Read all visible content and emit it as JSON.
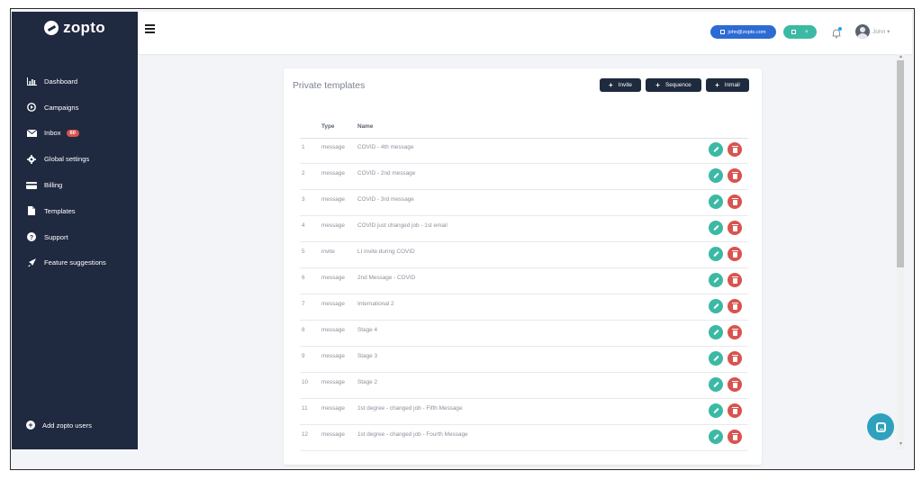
{
  "brand": {
    "logo_text": "zopto"
  },
  "sidebar": {
    "items": [
      {
        "label": "Dashboard",
        "icon": "bar-chart-icon"
      },
      {
        "label": "Campaigns",
        "icon": "play-circle-icon"
      },
      {
        "label": "Inbox",
        "icon": "envelope-icon",
        "badge": "60"
      },
      {
        "label": "Global settings",
        "icon": "gear-icon"
      },
      {
        "label": "Billing",
        "icon": "credit-card-icon"
      },
      {
        "label": "Templates",
        "icon": "file-icon"
      },
      {
        "label": "Support",
        "icon": "question-circle-icon"
      },
      {
        "label": "Feature suggestions",
        "icon": "rocket-icon"
      }
    ],
    "add_users_label": "Add zopto users"
  },
  "topbar": {
    "email": "john@zopto.com",
    "user_name": "John",
    "toggle_label": "×"
  },
  "card": {
    "title": "Private templates",
    "buttons": {
      "invite": "Invite",
      "sequence": "Sequence",
      "inmail": "Inmail"
    },
    "columns": {
      "type": "Type",
      "name": "Name"
    },
    "rows": [
      {
        "num": "1",
        "type": "message",
        "name": "COVID - 4th message"
      },
      {
        "num": "2",
        "type": "message",
        "name": "COVID - 2nd message"
      },
      {
        "num": "3",
        "type": "message",
        "name": "COVID - 3rd message"
      },
      {
        "num": "4",
        "type": "message",
        "name": "COVID just changed job - 1st email"
      },
      {
        "num": "5",
        "type": "invite",
        "name": "LI invite during COVID"
      },
      {
        "num": "6",
        "type": "message",
        "name": "2nd Message - COVID"
      },
      {
        "num": "7",
        "type": "message",
        "name": "International 2"
      },
      {
        "num": "8",
        "type": "message",
        "name": "Stage 4"
      },
      {
        "num": "9",
        "type": "message",
        "name": "Stage 3"
      },
      {
        "num": "10",
        "type": "message",
        "name": "Stage 2"
      },
      {
        "num": "11",
        "type": "message",
        "name": "1st degree - changed job - Fifth Message"
      },
      {
        "num": "12",
        "type": "message",
        "name": "1st degree - changed job - Fourth Message"
      }
    ]
  },
  "colors": {
    "sidebar_bg": "#1f2940",
    "primary_button": "#1e2a3e",
    "email_pill": "#2d6bd4",
    "accent_teal": "#3cb9a4",
    "danger_red": "#d9534f",
    "chat_button": "#2ea2bd"
  }
}
